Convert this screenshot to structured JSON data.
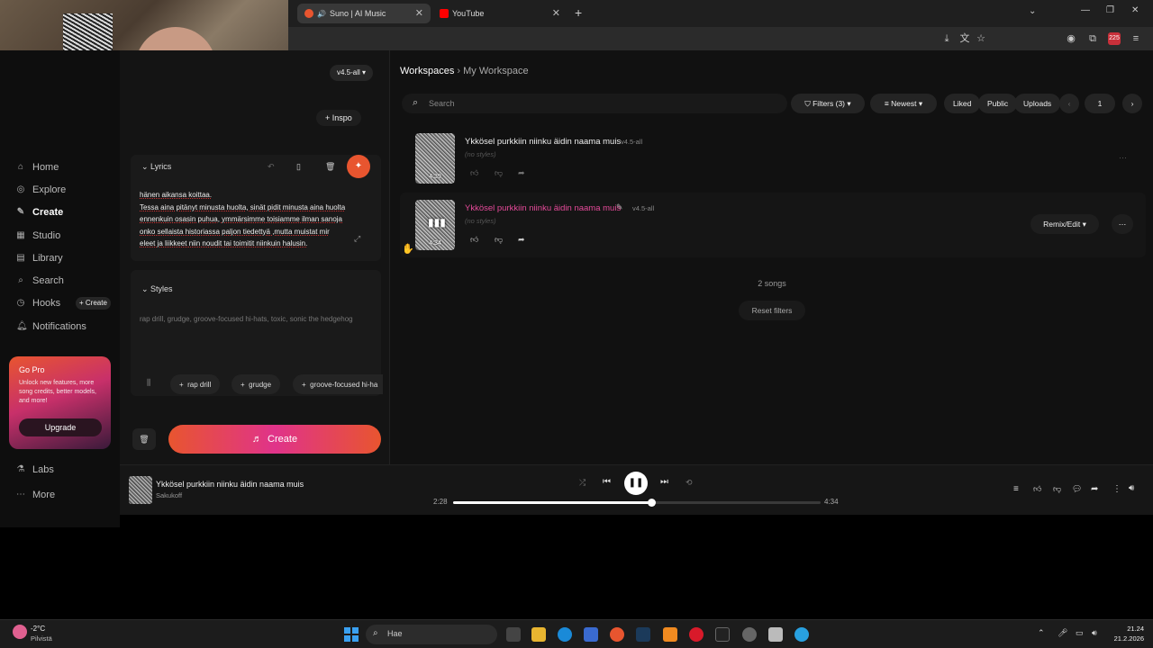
{
  "browser": {
    "tabs": [
      {
        "title": "Suno | AI Music",
        "fav_color": "#e8552f"
      },
      {
        "title": "YouTube",
        "fav_color": "#ff0000"
      }
    ],
    "new_tab": "+"
  },
  "sidebar": {
    "items": [
      {
        "label": "Home",
        "icon": "home-icon"
      },
      {
        "label": "Explore",
        "icon": "compass-icon"
      },
      {
        "label": "Create",
        "icon": "create-icon"
      },
      {
        "label": "Studio",
        "icon": "studio-icon"
      },
      {
        "label": "Library",
        "icon": "library-icon"
      },
      {
        "label": "Search",
        "icon": "search-icon"
      },
      {
        "label": "Hooks",
        "icon": "hooks-icon"
      },
      {
        "label": "Notifications",
        "icon": "bell-icon"
      }
    ],
    "hooks_create": "+ Create",
    "gopro": {
      "title": "Go Pro",
      "text": "Unlock new features, more song credits, better models, and more!",
      "button": "Upgrade"
    },
    "labs": "Labs",
    "more": "More"
  },
  "editor": {
    "model": "v4.5-all",
    "inspo": "Inspo",
    "lyrics_label": "Lyrics",
    "lyrics_lines": [
      "hänen aikansa koittaa.",
      "Tessa aina pitänyt minusta huolta, sinät pidit minusta aina huolta",
      "ennenkuin osasin puhua, ymmärsimme toisiamme ilman sanoja",
      "onko sellaista historiassa paljon tiedettyä ,mutta muistat mir",
      "eleet ja liikkeet niin noudit tai toimitit niinkuin halusin."
    ],
    "styles_label": "Styles",
    "styles_text": "rap drill, grudge, groove-focused hi-hats, toxic, sonic the hedgehog",
    "style_chips": [
      "rap drill",
      "grudge",
      "groove-focused hi-ha"
    ],
    "create_button": "Create"
  },
  "workspace": {
    "breadcrumb_root": "Workspaces",
    "breadcrumb_current": "My Workspace",
    "search_placeholder": "Search",
    "filters": "Filters (3)",
    "sort": "Newest",
    "liked": "Liked",
    "public": "Public",
    "uploads": "Uploads",
    "page": "1",
    "songs": [
      {
        "title": "Ykkösel purkkiin niinku äidin naama muis",
        "version": "v4.5-all",
        "styles": "(no styles)",
        "duration": "4:39"
      },
      {
        "title": "Ykkösel purkkiin niinku äidin naama muis",
        "version": "v4.5-all",
        "styles": "(no styles)",
        "duration": "4:34"
      }
    ],
    "remix_edit": "Remix/Edit",
    "count": "2 songs",
    "reset": "Reset filters"
  },
  "player": {
    "title": "Ykkösel purkkiin niinku äidin naama muis",
    "artist": "Sakukoff",
    "elapsed": "2:28",
    "total": "4:34",
    "progress": 0.54
  },
  "taskbar": {
    "weather_temp": "-2°C",
    "weather_desc": "Pilvistä",
    "search": "Hae",
    "time": "21.24",
    "date": "21.2.2026"
  },
  "colors": {
    "accent_orange": "#e8552f",
    "accent_pink": "#e0338a",
    "highlight_pink": "#e64a9a"
  }
}
